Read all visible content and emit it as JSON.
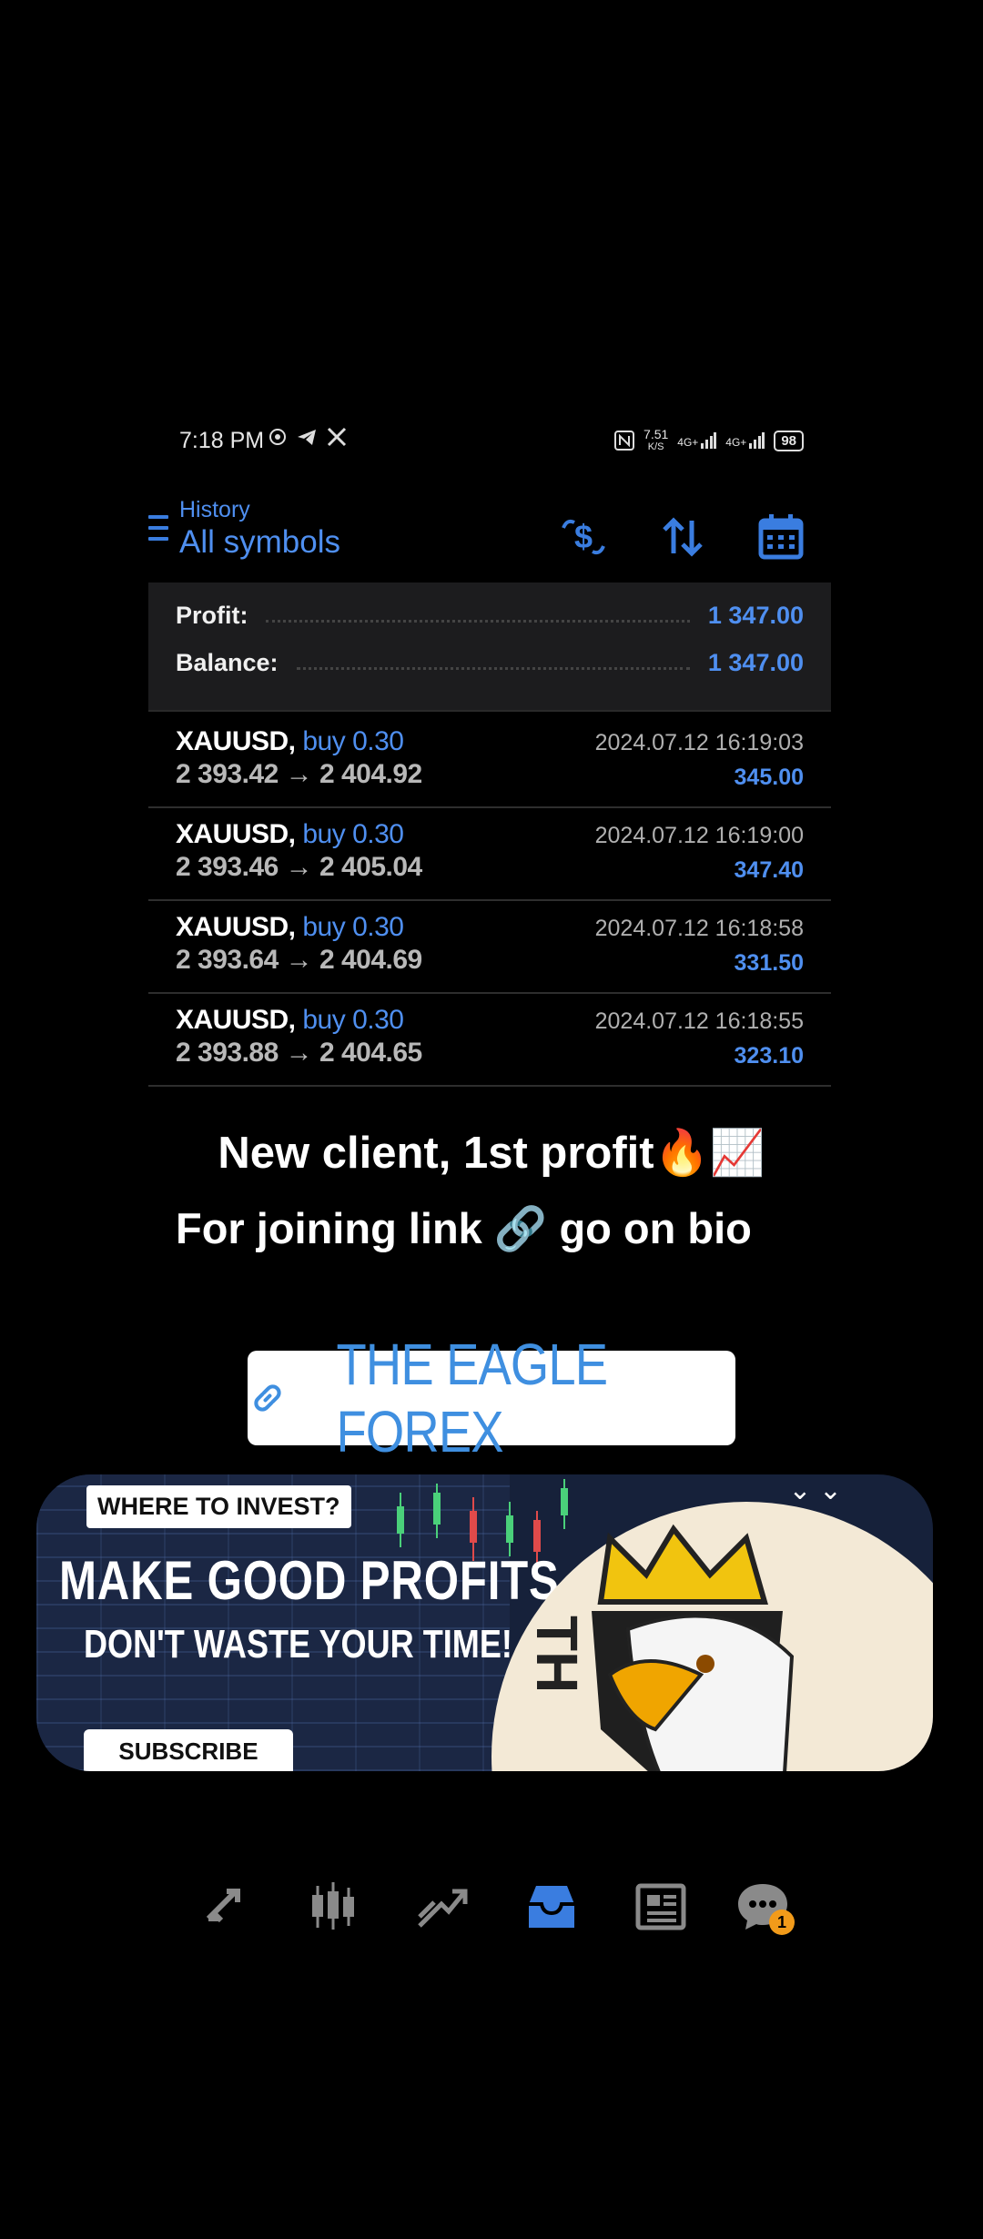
{
  "status_bar": {
    "time": "7:18 PM",
    "speed": "7.51",
    "speed_unit": "K/S",
    "net1": "4G+",
    "net2": "4G+",
    "battery": "98"
  },
  "header": {
    "subtitle": "History",
    "title": "All symbols",
    "icons": [
      "menu-icon",
      "currency-exchange-icon",
      "sort-icon",
      "calendar-icon"
    ]
  },
  "summary": {
    "profit_label": "Profit:",
    "profit_value": "1 347.00",
    "balance_label": "Balance:",
    "balance_value": "1 347.00"
  },
  "trades": [
    {
      "symbol": "XAUUSD,",
      "side": "buy 0.30",
      "prices": "2 393.42 → 2 404.92",
      "time": "2024.07.12 16:19:03",
      "profit": "345.00"
    },
    {
      "symbol": "XAUUSD,",
      "side": "buy 0.30",
      "prices": "2 393.46 → 2 405.04",
      "time": "2024.07.12 16:19:00",
      "profit": "347.40"
    },
    {
      "symbol": "XAUUSD,",
      "side": "buy 0.30",
      "prices": "2 393.64 → 2 404.69",
      "time": "2024.07.12 16:18:58",
      "profit": "331.50"
    },
    {
      "symbol": "XAUUSD,",
      "side": "buy 0.30",
      "prices": "2 393.88 → 2 404.65",
      "time": "2024.07.12 16:18:55",
      "profit": "323.10"
    }
  ],
  "overlay": {
    "caption1": "New client, 1st profit🔥📈",
    "caption2": "For joining link 🔗 go on bio",
    "link_label": "THE EAGLE FOREX"
  },
  "banner": {
    "where": "WHERE TO INVEST?",
    "headline": "MAKE GOOD PROFITS",
    "tagline": "DON'T WASTE YOUR TIME!",
    "subscribe": "SUBSCRIBE",
    "logo_letters": "TH"
  },
  "nav": {
    "items": [
      "quotes-icon",
      "chart-icon",
      "trade-icon",
      "history-icon",
      "news-icon",
      "messages-icon"
    ],
    "active": "history-icon",
    "badge": "1"
  },
  "colors": {
    "accent": "#4f8ff0",
    "background": "#000000",
    "summary_bg": "#1c1c1e",
    "badge": "#f29b1a"
  }
}
